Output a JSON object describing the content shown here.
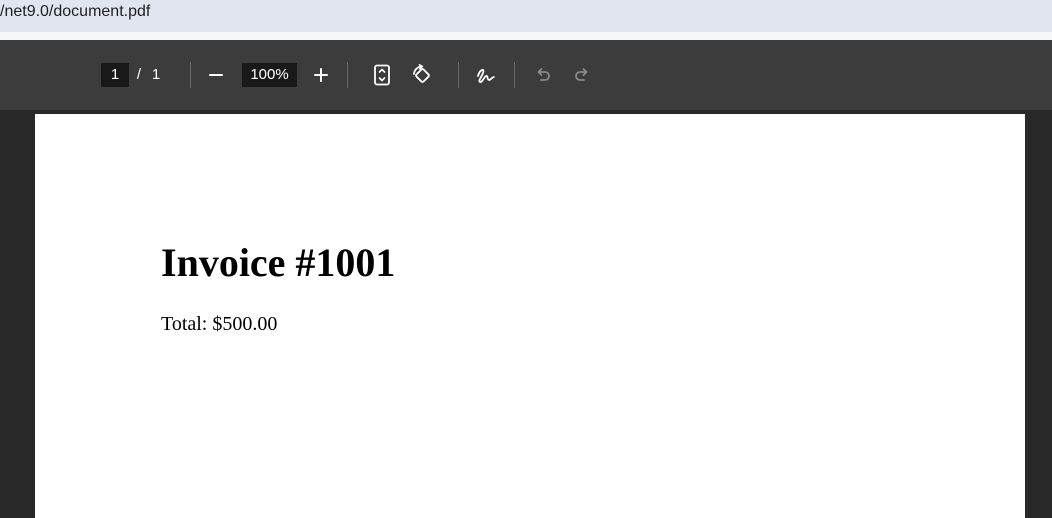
{
  "address_bar": {
    "url": "/net9.0/document.pdf"
  },
  "toolbar": {
    "page_current": "1",
    "page_separator": "/",
    "page_total": "1",
    "zoom_value": "100%",
    "icons": {
      "zoom_out": "minus-icon",
      "zoom_in": "plus-icon",
      "fit_page": "fit-to-page-icon",
      "rotate": "rotate-icon",
      "draw": "draw-signature-icon",
      "undo": "undo-icon",
      "redo": "redo-icon"
    }
  },
  "document": {
    "title": "Invoice #1001",
    "total_line": "Total: $500.00"
  },
  "colors": {
    "toolbar_bg": "#3c3c3c",
    "viewer_bg": "#282828",
    "address_bg": "#e1e5ef",
    "input_bg": "#191919",
    "disabled_icon": "#8a8a8a"
  }
}
